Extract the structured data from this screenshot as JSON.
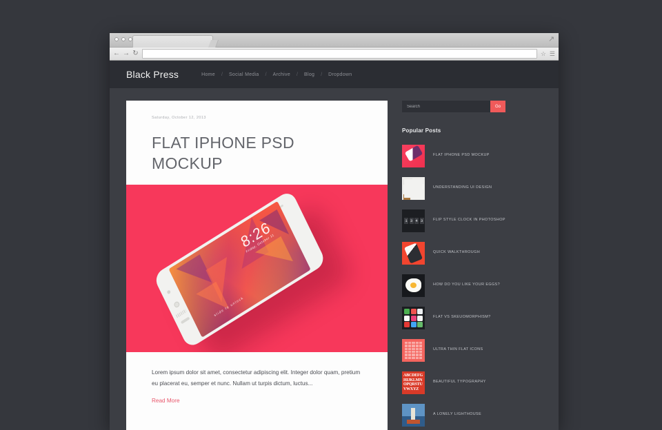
{
  "browser": {
    "tab_title": "",
    "url": "",
    "back_icon": "back-arrow-icon",
    "forward_icon": "forward-arrow-icon",
    "reload_icon": "reload-icon",
    "bookmark_icon": "star-icon",
    "menu_icon": "hamburger-menu-icon",
    "resize_icon": "resize-icon"
  },
  "site": {
    "brand": "Black Press",
    "nav": [
      {
        "label": "Home"
      },
      {
        "label": "Social Media"
      },
      {
        "label": "Archive"
      },
      {
        "label": "Blog"
      },
      {
        "label": "Dropdown"
      }
    ],
    "nav_separator": "/"
  },
  "article": {
    "date": "Saturday, October 12, 2013",
    "title": "FLAT IPHONE PSD MOCKUP",
    "hero": {
      "background_color": "#F7385B",
      "clock_time": "8:26",
      "clock_sub": "Friday, October 11",
      "slide_text": "slide to unlock"
    },
    "excerpt": "Lorem ipsum dolor sit amet, consectetur adipiscing elit. Integer dolor quam, pretium eu placerat eu, semper et nunc. Nullam ut turpis dictum, luctus...",
    "read_more": "Read More"
  },
  "sidebar": {
    "search": {
      "placeholder": "Search",
      "value": "",
      "button_label": "Go",
      "button_color": "#F05A5A"
    },
    "popular_title": "Popular Posts",
    "posts": [
      {
        "label": "FLAT IPHONE PSD MOCKUP",
        "thumb": "phone-thumb"
      },
      {
        "label": "UNDERSTANDING UI DESIGN",
        "thumb": "ui-thumb"
      },
      {
        "label": "FLIP STYLE CLOCK IN PHOTOSHOP",
        "thumb": "clock-thumb"
      },
      {
        "label": "QUICK WALKTHROUGH",
        "thumb": "walkthrough-thumb"
      },
      {
        "label": "HOW DO YOU LIKE YOUR EGGS?",
        "thumb": "egg-thumb"
      },
      {
        "label": "FLAT VS SKEUOMORPHISM?",
        "thumb": "icons-thumb"
      },
      {
        "label": "ULTRA THIN FLAT ICONS",
        "thumb": "flat-icons-thumb"
      },
      {
        "label": "BEAUTIFUL TYPOGRAPHY",
        "thumb": "typography-thumb"
      },
      {
        "label": "A LONELY LIGHTHOUSE",
        "thumb": "lighthouse-thumb"
      }
    ]
  },
  "theme": {
    "page_background": "#35373D",
    "header_background": "#2B2D33",
    "body_background": "#3C3E44",
    "accent_pink": "#F7385B",
    "link_color": "#E8566B"
  },
  "clock_thumb_digits": [
    "1",
    "3",
    "4",
    "3"
  ],
  "typography_thumb_text": "ABCDEFG HIJKLMN OPQRSTU VWXYZ"
}
